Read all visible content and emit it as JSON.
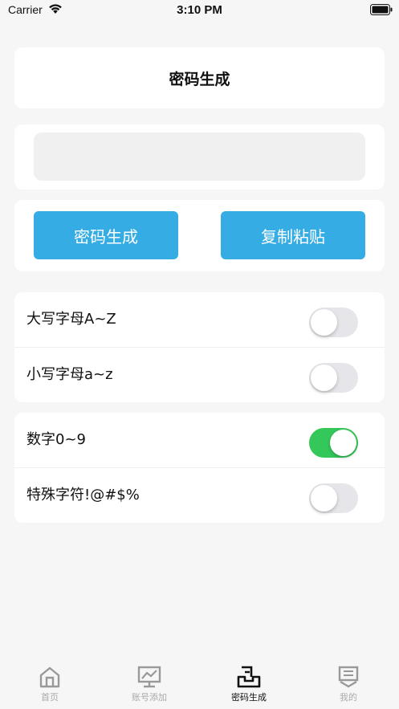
{
  "status_bar": {
    "carrier": "Carrier",
    "time": "3:10 PM"
  },
  "header": {
    "title": "密码生成"
  },
  "password_field": {
    "value": "",
    "placeholder": ""
  },
  "buttons": {
    "generate": "密码生成",
    "copy": "复制粘贴"
  },
  "options": [
    {
      "label": "大写字母A~Z",
      "on": false
    },
    {
      "label": "小写字母a~z",
      "on": false
    },
    {
      "label": "数字0~9",
      "on": true
    },
    {
      "label": "特殊字符!@#$%",
      "on": false
    }
  ],
  "tabbar": {
    "tabs": [
      {
        "label": "首页",
        "icon": "home-icon",
        "active": false
      },
      {
        "label": "账号添加",
        "icon": "chart-board-icon",
        "active": false
      },
      {
        "label": "密码生成",
        "icon": "inbox-tray-icon",
        "active": true
      },
      {
        "label": "我的",
        "icon": "profile-icon",
        "active": false
      }
    ]
  },
  "colors": {
    "accent": "#35ade4",
    "toggle_on": "#34c759",
    "toggle_off": "#e6e6ea",
    "background": "#f6f6f6"
  }
}
